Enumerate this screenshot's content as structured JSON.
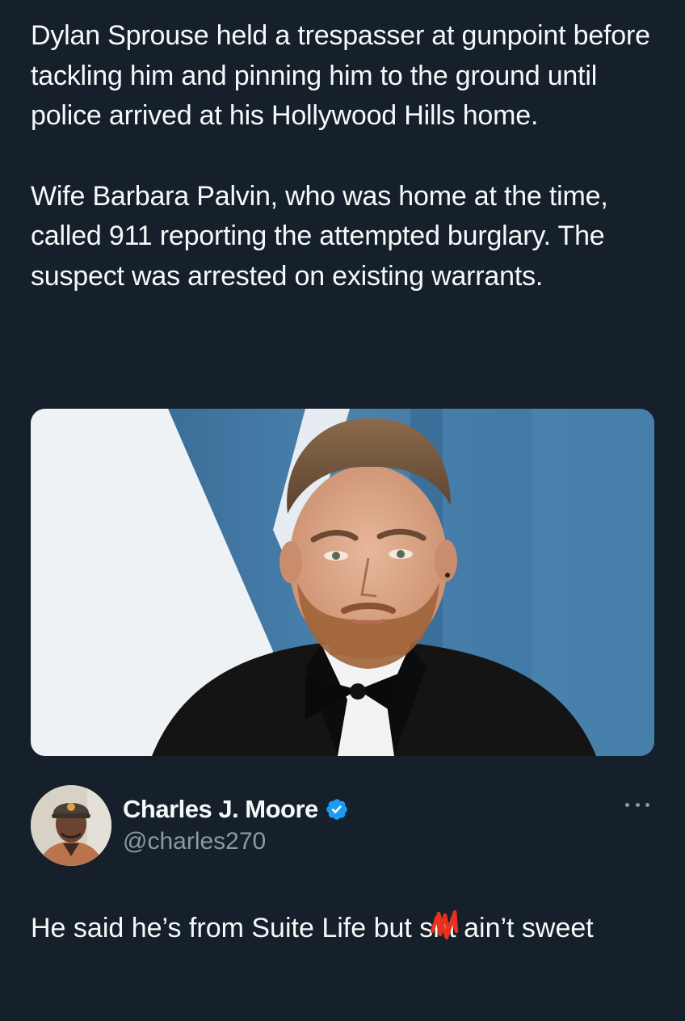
{
  "quoted_tweet": {
    "paragraphs": [
      "Dylan Sprouse held a trespasser at gunpoint before tackling him and pinning him to the ground until police arrived at his Hollywood Hills home.",
      "Wife Barbara Palvin, who was home at the time, called 911 reporting the attempted burglary. The suspect was arrested on existing warrants."
    ],
    "media": {
      "icon": "photo-of-man-in-tuxedo"
    }
  },
  "author": {
    "display_name": "Charles J. Moore",
    "handle": "@charles270",
    "verified": true,
    "verified_color": "#1d9bf0",
    "avatar_icon": "profile-photo"
  },
  "reply": {
    "text_before": "He said he’s from Suite Life but s",
    "censored": "h",
    "text_after": " ain’t sweet",
    "scribble_color": "#e8321e"
  },
  "colors": {
    "background": "#15202b",
    "text": "#f7f9f9",
    "secondary": "#8b98a5"
  }
}
